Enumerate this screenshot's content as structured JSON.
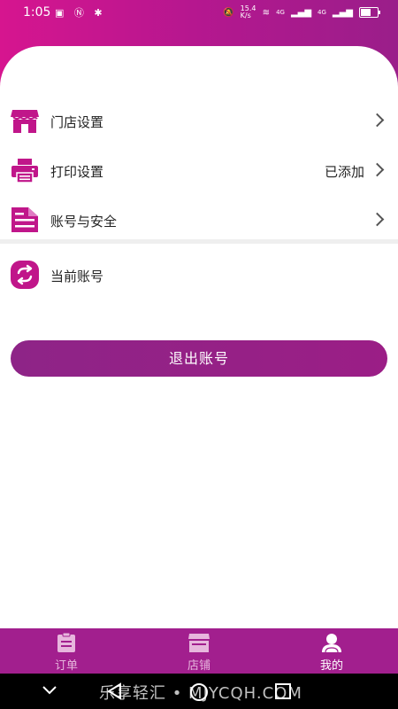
{
  "status_bar": {
    "time": "1:05",
    "network_speed": "15.4 K/s",
    "signal_tags": [
      "4G",
      "4G"
    ]
  },
  "menu": {
    "store_settings": {
      "label": "门店设置",
      "icon": "storefront-icon"
    },
    "print_settings": {
      "label": "打印设置",
      "value": "已添加",
      "icon": "printer-icon"
    },
    "account_security": {
      "label": "账号与安全",
      "icon": "document-icon"
    },
    "current_account": {
      "label": "当前账号",
      "icon": "switch-account-icon"
    }
  },
  "logout_label": "退出账号",
  "tabs": [
    {
      "label": "订单",
      "icon": "clipboard-icon",
      "active": false
    },
    {
      "label": "店铺",
      "icon": "shop-icon",
      "active": false
    },
    {
      "label": "我的",
      "icon": "user-icon",
      "active": true
    }
  ],
  "watermark": "乐享轻汇 • MJYCQH.COM",
  "colors": {
    "accent": "#b5178f",
    "tabbar": "#a21f8e",
    "button": "#8e2487"
  }
}
